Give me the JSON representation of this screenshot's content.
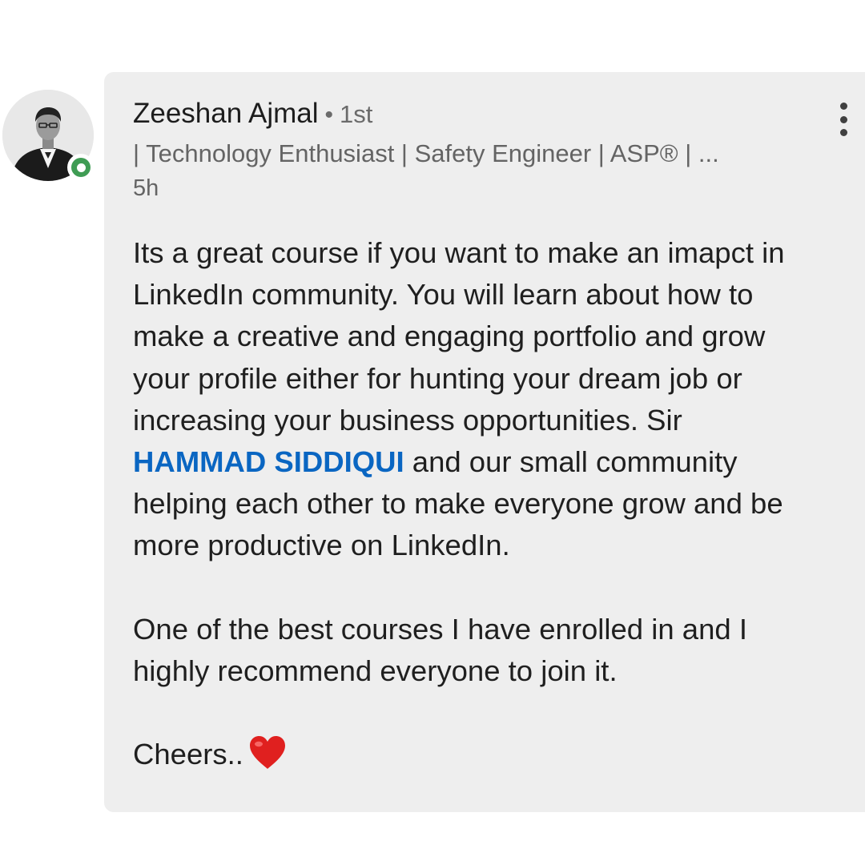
{
  "comment": {
    "author": {
      "name": "Zeeshan Ajmal",
      "separator": "•",
      "connection_degree": "1st",
      "headline": "| Technology Enthusiast | Safety Engineer | ASP® | ...",
      "online": true
    },
    "timestamp": "5h",
    "menu_icon": "more-vertical-icon",
    "paragraph_1": {
      "before_mention_lines": [
        "Its a great course if you want to make an imapct in",
        "LinkedIn community. You will learn about how to",
        "make a creative and engaging portfolio and grow",
        "your profile either for hunting your dream job or",
        "increasing your business opportunities. Sir"
      ],
      "mention": "HAMMAD SIDDIQUI",
      "after_mention": " and our small community",
      "after_mention_lines": [
        "helping each other to make everyone grow and be",
        "more productive on LinkedIn."
      ]
    },
    "paragraph_2_lines": [
      "One of the best courses I have enrolled in and I",
      "highly recommend everyone to join it."
    ],
    "sign_off": "Cheers..",
    "sign_off_icon": "heart-icon"
  },
  "colors": {
    "bubble_bg": "#eeeeee",
    "mention": "#0a66c2",
    "presence": "#3f9c54",
    "heart": "#e0201f"
  }
}
